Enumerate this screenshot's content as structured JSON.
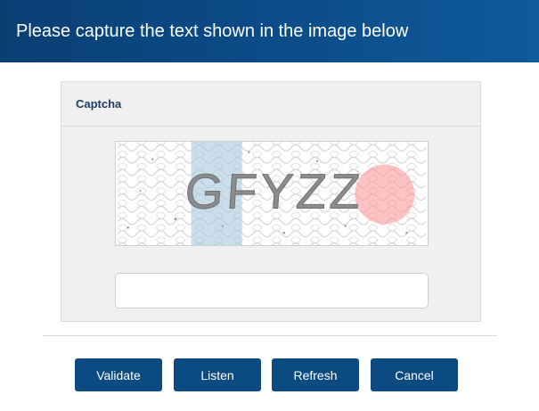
{
  "header": {
    "title": "Please capture the text shown in the image below"
  },
  "panel": {
    "title": "Captcha"
  },
  "captcha": {
    "text": "GFYZZ",
    "input_value": "",
    "input_placeholder": ""
  },
  "buttons": {
    "validate": "Validate",
    "listen": "Listen",
    "refresh": "Refresh",
    "cancel": "Cancel"
  },
  "colors": {
    "header_bg": "#0b4a86",
    "button_bg": "#0c4b82",
    "panel_title": "#1f3c66",
    "panel_bg": "#f0f0f0"
  }
}
